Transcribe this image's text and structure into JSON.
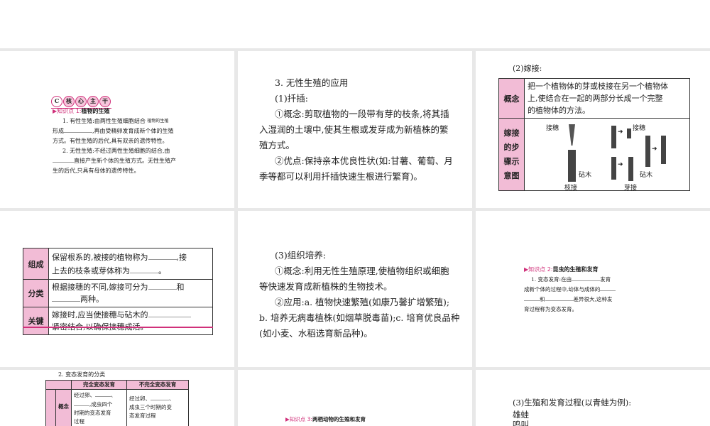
{
  "slides": [
    {
      "banner": [
        "核",
        "心",
        "主",
        "干"
      ],
      "kp": "知识点 1:",
      "kp_title": "植物的生殖",
      "note": "植物的生殖",
      "p1a": "1. 有性生殖:由两性生殖细胞结合",
      "p1b": "形成",
      "p1c": ",再由受精卵发育成新个体的生殖",
      "p1d": "方式。有性生殖的后代,具有双亲的遗传特性。",
      "p2a": "2. 无性生殖:不经过两性生殖细胞的结合,由",
      "p2b": "直接产生新个体的生殖方式。无性生殖产",
      "p2c": "生的后代,只具有母体的遗传特性。"
    },
    {
      "title": "3. 无性生殖的应用",
      "sub": "(1)扦插:",
      "l1": "①概念:剪取植物的一段带有芽的枝条,将其插",
      "l2": "入湿润的土壤中,使其生根或发芽成为新植株的繁",
      "l3": "殖方式。",
      "l4": "②优点:保持亲本优良性状(如:甘薯、葡萄、月",
      "l5": "季等都可以利用扦插快速生根进行繁育)。"
    },
    {
      "title": "(2)嫁接:",
      "concept_label": "概念",
      "concept": [
        "把一个植物体的芽或枝接在另一个植物体",
        "上,使结合在一起的两部分长成一个完整",
        "的植物体的方法。"
      ],
      "steps_label": [
        "嫁接",
        "的步",
        "骤示",
        "意图"
      ],
      "scion": "接穗",
      "stock": "砧木",
      "branch": "枝接",
      "bud": "芽接"
    },
    {
      "rows": [
        {
          "label": "组成",
          "l1a": "保留根系的,被接的植物称为",
          "l1b": ",接",
          "l2a": "上去的枝条或芽体称为",
          "l2b": "。"
        },
        {
          "label": "分类",
          "l1a": "根据接穗的不同,嫁接可分为",
          "l1b": "和",
          "l2a": "",
          "l2b": "两种。"
        },
        {
          "label": "关键",
          "l1a": "嫁接时,应当使接穗与砧木的",
          "l1b": "",
          "l2a": "紧密结合,以确保接穗成活。",
          "l2b": ""
        }
      ]
    },
    {
      "sub": "(3)组织培养:",
      "l1": "①概念:利用无性生殖原理,使植物组织或细胞",
      "l2": "等快速发育成新植株的生物技术。",
      "l3": "②应用:a. 植物快速繁殖(如康乃馨扩增繁殖);",
      "l4": "b. 培养无病毒植株(如烟草脱毒苗);c. 培育优良品种",
      "l5": "(如小麦、水稻选育新品种)。"
    },
    {
      "kp": "知识点 2:",
      "kp_title": "昆虫的生殖和发育",
      "l1a": "1. 变态发育:在由",
      "l1b": "发育",
      "l2": "成新个体的过程中,幼体与成体的",
      "l3a": "和",
      "l3b": "差异很大,这种发",
      "l4": "育过程称为变态发育。"
    },
    {
      "title": "2. 变态发育的分类",
      "h1": "完全变态发育",
      "h2": "不完全变态发育",
      "row_label": "概念",
      "c1": [
        "经过卵、",
        "、",
        "",
        ",成虫四个",
        "时期的变态发育",
        "过程"
      ],
      "c2": [
        "经过卵、",
        "、",
        "成虫三个时期的变",
        "态发育过程"
      ]
    },
    {
      "kp": "知识点 3:",
      "kp_title": "两栖动物的生殖和发育"
    },
    {
      "title": "(3)生殖和发育过程(以青蛙为例):",
      "l1": "雄蛙",
      "l2": "鸣叫"
    }
  ]
}
